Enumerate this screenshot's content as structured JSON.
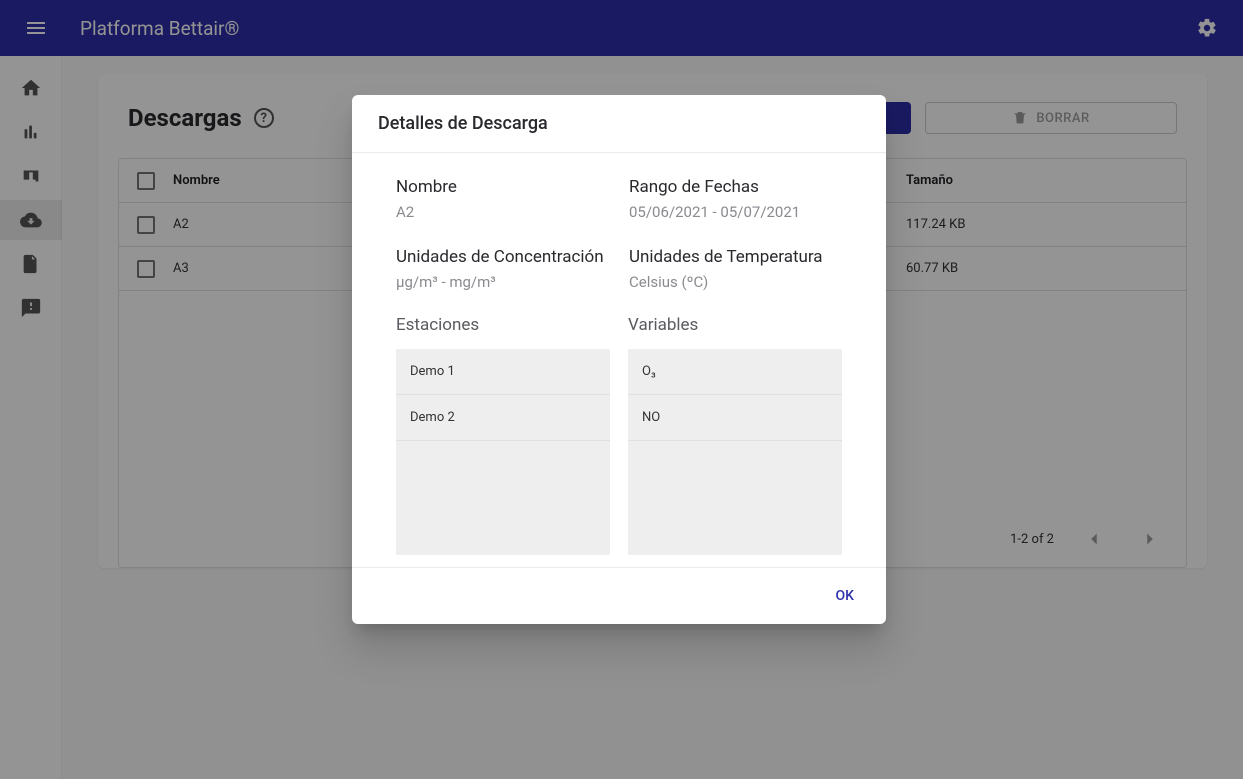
{
  "appbar": {
    "title": "Platforma Bettair®"
  },
  "page": {
    "title": "Descargas"
  },
  "toolbar": {
    "delete_label": "BORRAR"
  },
  "table": {
    "headers": {
      "name": "Nombre",
      "size": "Tamaño"
    },
    "rows": [
      {
        "name": "A2",
        "size": "117.24 KB"
      },
      {
        "name": "A3",
        "size": "60.77 KB"
      }
    ],
    "pagination": "1-2 of 2"
  },
  "dialog": {
    "title": "Detalles de Descarga",
    "fields": {
      "name_label": "Nombre",
      "name_value": "A2",
      "daterange_label": "Rango de Fechas",
      "daterange_value": "05/06/2021 - 05/07/2021",
      "conc_label": "Unidades de Concentración",
      "conc_value": "µg/m³ - mg/m³",
      "temp_label": "Unidades de Temperatura",
      "temp_value": "Celsius (ºC)"
    },
    "stations_label": "Estaciones",
    "stations": [
      "Demo 1",
      "Demo 2"
    ],
    "variables_label": "Variables",
    "variables": [
      "O₃",
      "NO"
    ],
    "ok_label": "OK"
  }
}
